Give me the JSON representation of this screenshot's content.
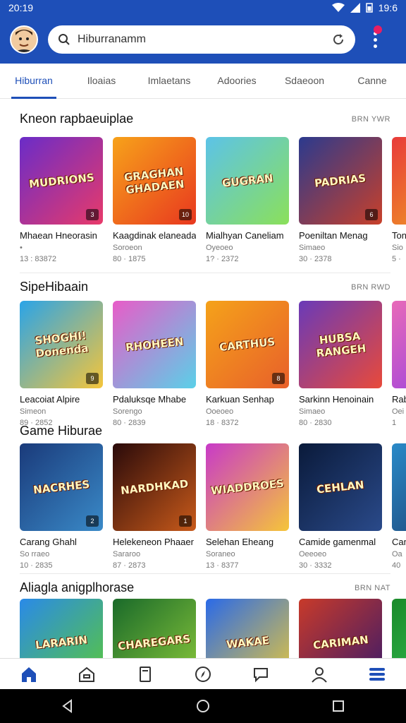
{
  "status": {
    "time": "20:19",
    "right_time": "19:6"
  },
  "search": {
    "value": "Hiburranamm"
  },
  "tabs": [
    {
      "label": "Hiburran",
      "active": true
    },
    {
      "label": "Iloaias",
      "active": false
    },
    {
      "label": "Imlaetans",
      "active": false
    },
    {
      "label": "Adoories",
      "active": false
    },
    {
      "label": "Sdaeoon",
      "active": false
    },
    {
      "label": "Canne",
      "active": false
    }
  ],
  "sections": [
    {
      "title": "Kneon rapbaeuiplae",
      "more": "BRN YWR",
      "items": [
        {
          "title": "Mhaean Hneorasin",
          "meta": "•",
          "stat": "13 : 83872",
          "art": "MUDRIONS",
          "badge": "3",
          "colors": [
            "#6a2cc8",
            "#e83a6a"
          ]
        },
        {
          "title": "Kaagdinak elaneadar",
          "meta": "Soroeon",
          "stat": "80 · 1875",
          "art": "GRAGHAN GHADAEN",
          "badge": "10",
          "colors": [
            "#f7a21a",
            "#e8381f"
          ]
        },
        {
          "title": "Mialhyan Caneliam",
          "meta": "Oyeoeo",
          "stat": "1? · 2372",
          "art": "GUGRAN",
          "badge": "",
          "colors": [
            "#5cc3e8",
            "#8be05a"
          ]
        },
        {
          "title": "Poeniltan Menag",
          "meta": "Simaeo",
          "stat": "30 · 2378",
          "art": "PADRIAS",
          "badge": "6",
          "colors": [
            "#2b3a8e",
            "#c8402a"
          ]
        },
        {
          "title": "Ton",
          "meta": "Sio",
          "stat": "5 ·",
          "art": "",
          "badge": "",
          "colors": [
            "#e83a3a",
            "#f0b020"
          ]
        }
      ]
    },
    {
      "title": "SipeHibaain",
      "more": "BRN RWD",
      "items": [
        {
          "title": "Leacoiat Alpire",
          "meta": "Simeon",
          "stat": "89 · 2852",
          "art": "SHOGHI! Donenda",
          "badge": "9",
          "colors": [
            "#2aa4e8",
            "#f5c53a"
          ]
        },
        {
          "title": "Pdaluksqe Mhabe",
          "meta": "Sorengo",
          "stat": "80 · 2839",
          "art": "RHOHEEN",
          "badge": "",
          "colors": [
            "#e85cc8",
            "#5ad0e8"
          ]
        },
        {
          "title": "Karkuan Senhap",
          "meta": "Ooeoeo",
          "stat": "18 · 8372",
          "art": "CARTHUS",
          "badge": "8",
          "colors": [
            "#f5a21a",
            "#e8602a"
          ]
        },
        {
          "title": "Sarkinn Henoinain",
          "meta": "Simaeo",
          "stat": "80 · 2830",
          "art": "HUBSA RANGEH",
          "badge": "",
          "colors": [
            "#6a3ab8",
            "#e84a3a"
          ]
        },
        {
          "title": "Rab",
          "meta": "Oei",
          "stat": "1",
          "art": "",
          "badge": "",
          "colors": [
            "#e86ab8",
            "#8a3ae8"
          ]
        }
      ]
    },
    {
      "title": "Game Hiburae",
      "more": "",
      "items": [
        {
          "title": "Carang Ghahl",
          "meta": "So rraeo",
          "stat": "10 · 2835",
          "art": "NACRHES",
          "badge": "2",
          "colors": [
            "#1a3a7a",
            "#3a8ac8"
          ]
        },
        {
          "title": "Helekeneon Phaaer",
          "meta": "Sararoo",
          "stat": "87 · 2873",
          "art": "NARDHKAD",
          "badge": "1",
          "colors": [
            "#2a0a0a",
            "#c85a1a"
          ]
        },
        {
          "title": "Selehan Eheang",
          "meta": "Soraneo",
          "stat": "13 · 8377",
          "art": "WIADDROES",
          "badge": "",
          "colors": [
            "#c83ac8",
            "#f5c53a"
          ]
        },
        {
          "title": "Camide gamenmal",
          "meta": "Oeeoeo",
          "stat": "30 · 3332",
          "art": "CEHLAN",
          "badge": "",
          "colors": [
            "#0a1a3a",
            "#2a4a8a"
          ]
        },
        {
          "title": "Can",
          "meta": "Oa",
          "stat": "40",
          "art": "",
          "badge": "",
          "colors": [
            "#2a8ac8",
            "#1a3a6a"
          ]
        }
      ]
    },
    {
      "title": "Aliagla anigplhorase",
      "more": "BRN NAT",
      "items": [
        {
          "title": "",
          "meta": "",
          "stat": "",
          "art": "LARARIN",
          "badge": "",
          "colors": [
            "#2a8ae8",
            "#5ac83a"
          ]
        },
        {
          "title": "",
          "meta": "",
          "stat": "",
          "art": "CHAREGARS",
          "badge": "",
          "colors": [
            "#1a6a2a",
            "#8ac83a"
          ]
        },
        {
          "title": "",
          "meta": "",
          "stat": "",
          "art": "WAKAE",
          "badge": "",
          "colors": [
            "#2a6ae8",
            "#e8c83a"
          ]
        },
        {
          "title": "",
          "meta": "",
          "stat": "",
          "art": "CARIMAN",
          "badge": "",
          "colors": [
            "#c83a2a",
            "#3a1a6a"
          ]
        },
        {
          "title": "",
          "meta": "",
          "stat": "",
          "art": "",
          "badge": "",
          "colors": [
            "#1a8a2a",
            "#3ac85a"
          ]
        }
      ]
    }
  ],
  "bottom_nav": [
    {
      "icon": "home-icon",
      "active": true
    },
    {
      "icon": "store-icon",
      "active": false
    },
    {
      "icon": "tablet-icon",
      "active": false
    },
    {
      "icon": "compass-icon",
      "active": false
    },
    {
      "icon": "chat-icon",
      "active": false
    },
    {
      "icon": "profile-icon",
      "active": false
    },
    {
      "icon": "menu-icon",
      "active": true
    }
  ],
  "colors": {
    "primary": "#1e4fb8",
    "text": "#111111",
    "muted": "#777777"
  }
}
